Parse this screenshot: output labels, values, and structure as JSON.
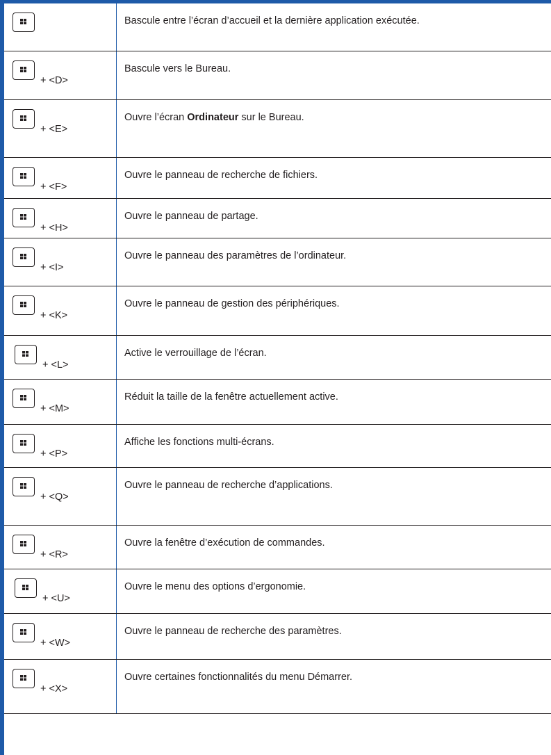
{
  "rows": [
    {
      "key": "",
      "text": "Bascule entre l’écran d’accueil et la dernière application exécutée."
    },
    {
      "key": "+ <D>",
      "text": "Bascule vers le Bureau."
    },
    {
      "key": "+ <E>",
      "text_before": "Ouvre l’écran ",
      "text_bold": "Ordinateur",
      "text_after": " sur le Bureau."
    },
    {
      "key": "+ <F>",
      "text": "Ouvre le panneau de recherche de fichiers."
    },
    {
      "key": "+ <H>",
      "text": "Ouvre le panneau de partage."
    },
    {
      "key": "+ <I>",
      "text": "Ouvre le panneau des paramètres de l’ordinateur."
    },
    {
      "key": "+ <K>",
      "text": "Ouvre le panneau de gestion des périphériques."
    },
    {
      "key": "+ <L>",
      "text": "Active le verrouillage de l’écran."
    },
    {
      "key": "+ <M>",
      "text": "Réduit la taille de la fenêtre actuellement active."
    },
    {
      "key": "+ <P>",
      "text": "Affiche les fonctions multi-écrans."
    },
    {
      "key": "+ <Q>",
      "text": "Ouvre le panneau de recherche d’applications."
    },
    {
      "key": "+ <R>",
      "text": "Ouvre la fenêtre d’exécution de commandes."
    },
    {
      "key": "+ <U>",
      "text": "Ouvre le menu des options d’ergonomie."
    },
    {
      "key": "+ <W>",
      "text": "Ouvre le panneau de recherche des paramètres."
    },
    {
      "key": "+ <X>",
      "text": "Ouvre certaines fonctionnalités du menu Démarrer."
    }
  ]
}
